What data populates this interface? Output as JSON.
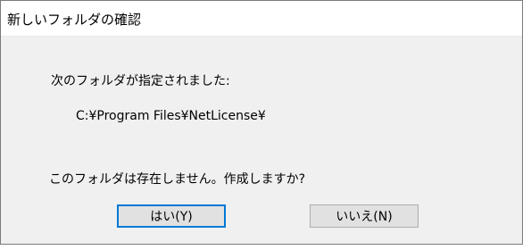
{
  "window": {
    "title": "新しいフォルダの確認"
  },
  "message": {
    "line1": "次のフォルダが指定されました:",
    "path": "C:¥Program Files¥NetLicense¥",
    "question": "このフォルダは存在しません。作成しますか?"
  },
  "buttons": {
    "yes_label": "はい(Y)",
    "no_label": "いいえ(N)"
  },
  "colors": {
    "default_button_border": "#0078d7",
    "dialog_background": "#f0f0f0",
    "title_background": "#ffffff"
  }
}
